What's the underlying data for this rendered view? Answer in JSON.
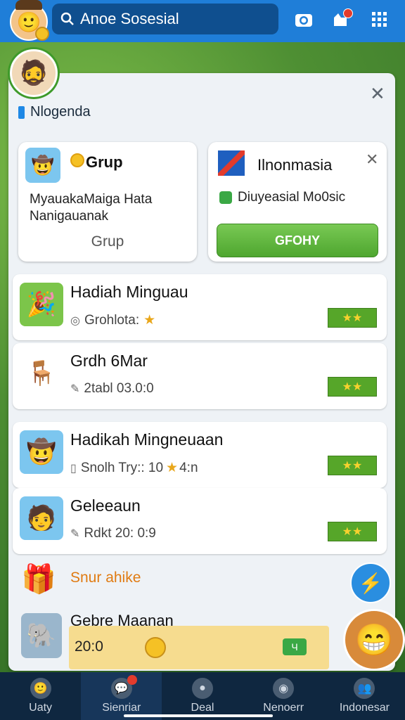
{
  "topbar": {
    "search_text": "Anoe Sosesial",
    "icons": [
      "camera-icon",
      "notification-icon",
      "grid-menu-icon"
    ]
  },
  "section": {
    "title": "Nlogenda"
  },
  "group_card": {
    "title": "Grup",
    "description": "MyauakaMaiga Hata Nanigauanak",
    "footer": "Grup"
  },
  "indonesia_card": {
    "title": "Ilnonmasia",
    "subtitle": "Diuyeasial Mo0sic",
    "button": "GFOHY"
  },
  "rows": [
    {
      "name": "Hadiah Minguau",
      "meta": "Grohlota:",
      "icon": "party-hat-icon",
      "has_star": true
    },
    {
      "name": "Grdh 6Mar",
      "meta": "2tabl 03.0:0",
      "icon": "chair-icon",
      "has_star": false
    },
    {
      "name": "Hadikah Mingneuaan",
      "meta": "Snolh Try:: 10",
      "meta_extra": "4:n",
      "icon": "avatar-icon",
      "has_star": false
    },
    {
      "name": "Geleeaun",
      "meta": "Rdkt 20: 0:9",
      "icon": "avatar-icon",
      "has_star": false
    }
  ],
  "promo": {
    "title": "Snur ahike"
  },
  "last_row": {
    "name": "Gebre Maanan",
    "value": "20:0",
    "tag": "Ч"
  },
  "bottom_nav": [
    {
      "label": "Uaty",
      "active": false
    },
    {
      "label": "Sienriar",
      "active": true,
      "badge": true
    },
    {
      "label": "Deal",
      "active": false
    },
    {
      "label": "Nenoerr",
      "active": false
    },
    {
      "label": "Indonesar",
      "active": false
    }
  ],
  "colors": {
    "primary": "#1f7ed8",
    "accent_green": "#56a629",
    "gold": "#f5c125",
    "nav_bg": "#0f2740"
  }
}
